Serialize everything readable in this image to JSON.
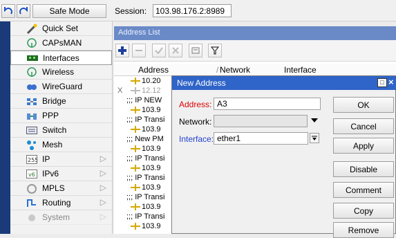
{
  "toolbar": {
    "undo_icon": "undo-icon",
    "redo_icon": "redo-icon",
    "safe_mode_label": "Safe Mode",
    "session_label": "Session:",
    "session_value": "103.98.176.2:8989"
  },
  "sidebar": {
    "items": [
      {
        "label": "Quick Set",
        "icon": "wand-icon",
        "arrow": ""
      },
      {
        "label": "CAPsMAN",
        "icon": "capsman-icon",
        "arrow": ""
      },
      {
        "label": "Interfaces",
        "icon": "interfaces-icon",
        "arrow": ""
      },
      {
        "label": "Wireless",
        "icon": "wireless-icon",
        "arrow": ""
      },
      {
        "label": "WireGuard",
        "icon": "wireguard-icon",
        "arrow": ""
      },
      {
        "label": "Bridge",
        "icon": "bridge-icon",
        "arrow": ""
      },
      {
        "label": "PPP",
        "icon": "ppp-icon",
        "arrow": ""
      },
      {
        "label": "Switch",
        "icon": "switch-icon",
        "arrow": ""
      },
      {
        "label": "Mesh",
        "icon": "mesh-icon",
        "arrow": ""
      },
      {
        "label": "IP",
        "icon": "ip-icon",
        "arrow": "▷"
      },
      {
        "label": "IPv6",
        "icon": "ipv6-icon",
        "arrow": "▷"
      },
      {
        "label": "MPLS",
        "icon": "mpls-icon",
        "arrow": "▷"
      },
      {
        "label": "Routing",
        "icon": "routing-icon",
        "arrow": "▷"
      },
      {
        "label": "System",
        "icon": "system-icon",
        "arrow": "▷"
      }
    ]
  },
  "address_list": {
    "title": "Address List",
    "columns": [
      "Address",
      "Network",
      "Interface"
    ],
    "rows": [
      {
        "mark": "",
        "text": "10.20"
      },
      {
        "mark": "X",
        "text": "12.12"
      },
      {
        "mark": "",
        "text": ";;; IP NEW"
      },
      {
        "mark": "",
        "text": "103.9"
      },
      {
        "mark": "",
        "text": ";;; IP Transi"
      },
      {
        "mark": "",
        "text": "103.9"
      },
      {
        "mark": "",
        "text": ";;; New PM"
      },
      {
        "mark": "",
        "text": "103.9"
      },
      {
        "mark": "",
        "text": ";;; IP Transi"
      },
      {
        "mark": "",
        "text": "103.9"
      },
      {
        "mark": "",
        "text": ";;; IP Transi"
      },
      {
        "mark": "",
        "text": "103.9"
      },
      {
        "mark": "",
        "text": ";;; IP Transi"
      },
      {
        "mark": "",
        "text": "103.9"
      },
      {
        "mark": "",
        "text": ";;; IP Transi"
      },
      {
        "mark": "",
        "text": "103.9"
      }
    ]
  },
  "dialog": {
    "title": "New Address",
    "address_label": "Address:",
    "address_value": "A3",
    "network_label": "Network:",
    "network_value": "",
    "interface_label": "Interface:",
    "interface_value": "ether1",
    "buttons": [
      "OK",
      "Cancel",
      "Apply",
      "Disable",
      "Comment",
      "Copy",
      "Remove"
    ]
  },
  "colors": {
    "sidebar_strip": "#1a3a7a",
    "dialog_titlebar": "#2f64c8",
    "list_titlebar": "#6a8ac7",
    "address_label": "#e00000",
    "interface_label": "#1f3fd0"
  }
}
